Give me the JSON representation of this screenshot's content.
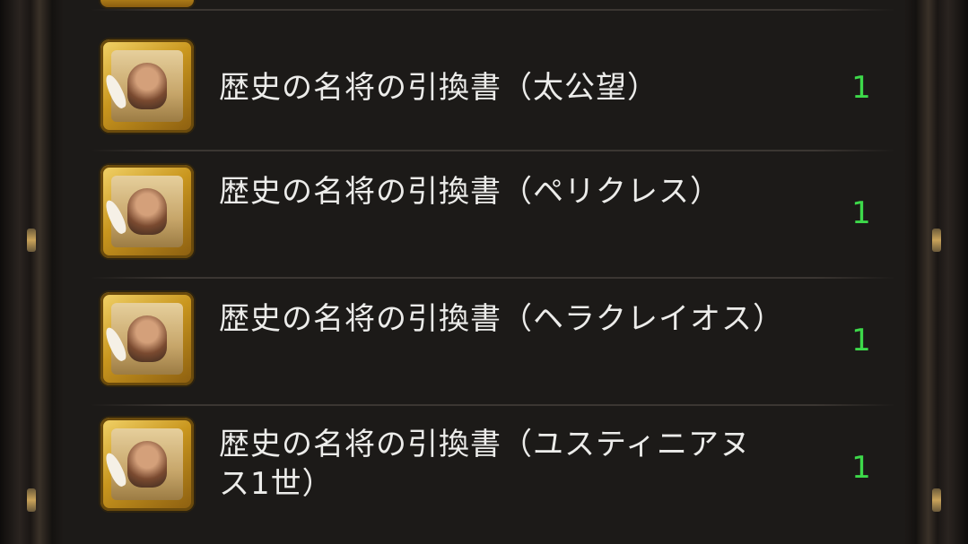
{
  "items": [
    {
      "name": "歴史の名将の引換書（太公望）",
      "quantity": "1",
      "icon": "scroll-portrait-taigong-icon"
    },
    {
      "name": "歴史の名将の引換書（ペリクレス）",
      "quantity": "1",
      "icon": "scroll-portrait-pericles-icon"
    },
    {
      "name": "歴史の名将の引換書（ヘラクレイオス）",
      "quantity": "1",
      "icon": "scroll-portrait-heraclius-icon"
    },
    {
      "name": "歴史の名将の引換書（ユスティニアヌス1世）",
      "quantity": "1",
      "icon": "scroll-portrait-justinian-icon"
    }
  ],
  "colors": {
    "quantity": "#3dd94a",
    "text": "#ececea",
    "icon_gold": "#c9961e"
  }
}
